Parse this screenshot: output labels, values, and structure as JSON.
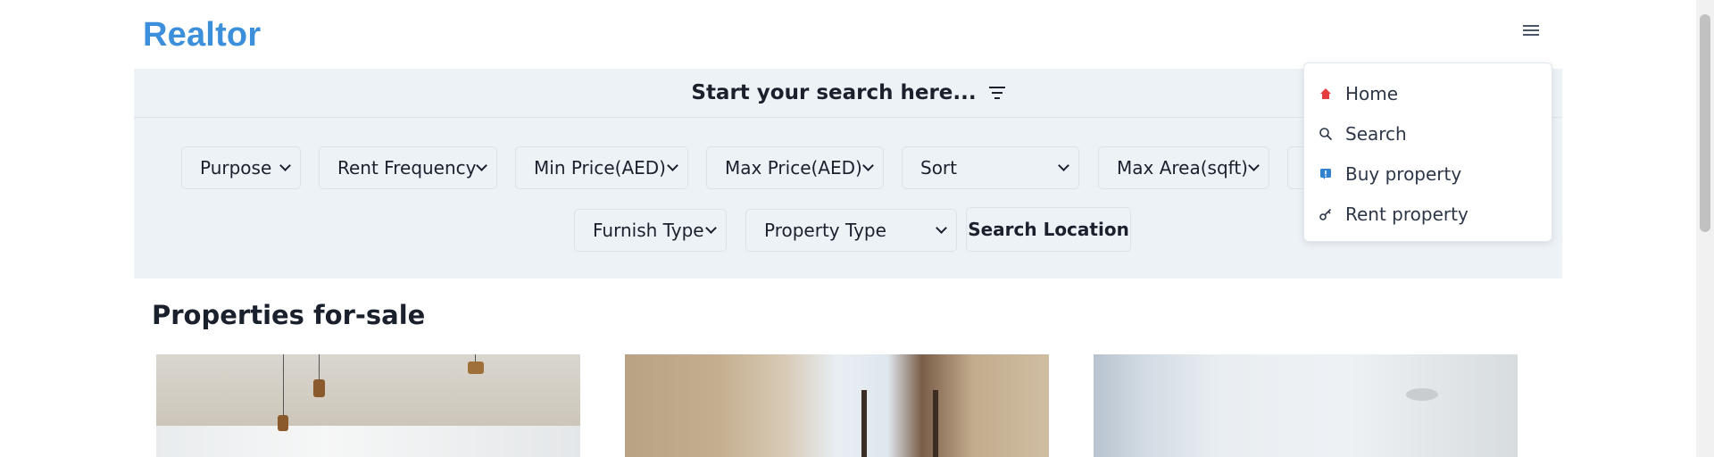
{
  "brand": {
    "name": "Realtor"
  },
  "search": {
    "title": "Start your search here...",
    "filters": [
      {
        "label": "Purpose"
      },
      {
        "label": "Rent Frequency"
      },
      {
        "label": "Min Price(AED)"
      },
      {
        "label": "Max Price(AED)"
      },
      {
        "label": "Sort"
      },
      {
        "label": "Max Area(sqft)"
      },
      {
        "label": "Furnish Type"
      },
      {
        "label": "Property Type"
      }
    ],
    "location_button": "Search Location"
  },
  "section": {
    "title": "Properties for-sale"
  },
  "menu": {
    "items": [
      {
        "label": "Home",
        "icon": "home-icon"
      },
      {
        "label": "Search",
        "icon": "search-icon"
      },
      {
        "label": "Buy property",
        "icon": "info-badge-icon"
      },
      {
        "label": "Rent property",
        "icon": "key-icon"
      }
    ]
  },
  "colors": {
    "brand": "#3b8fdb",
    "panel": "#edf2f7",
    "text": "#1a202c"
  }
}
